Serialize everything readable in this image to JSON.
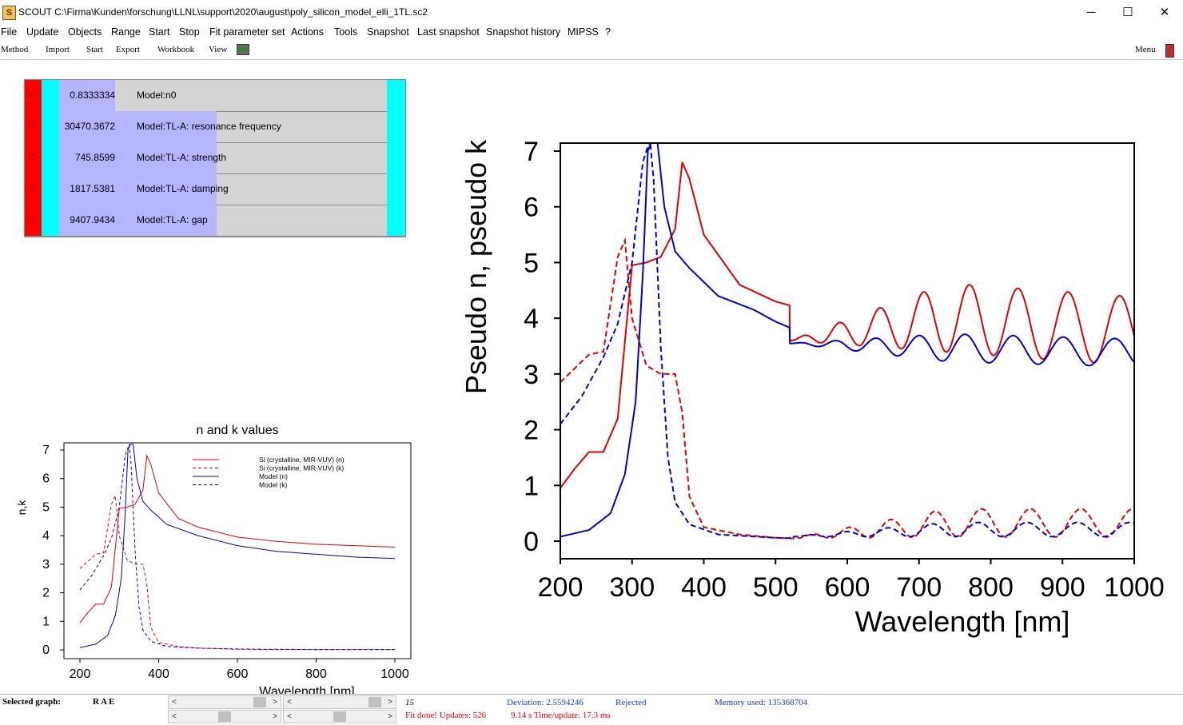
{
  "window": {
    "title": "SCOUT C:\\Firma\\Kunden\\forschung\\LLNL\\support\\2020\\august\\poly_silicon_model_elli_1TL.sc2",
    "minimize": "─",
    "maximize": "☐",
    "close": "✕"
  },
  "menu": [
    "File",
    "Update",
    "Objects",
    "Range",
    "Start",
    "Stop",
    "Fit parameter set",
    "Actions",
    "Tools",
    "Snapshot",
    "Last snapshot",
    "Snapshot history",
    "MIPSS",
    "?"
  ],
  "toolbar": {
    "items": [
      "Method",
      "Import",
      "Start",
      "Export",
      "Workbook",
      "View"
    ],
    "menu_label": "Menu"
  },
  "parameters": [
    {
      "flag": "D",
      "value": "0.8333334",
      "name": "Model:n0",
      "fill": 0
    },
    {
      "flag": "D",
      "value": "30470.3672",
      "name": "Model:TL-A: resonance frequency",
      "fill": 0.48
    },
    {
      "flag": "D",
      "value": "745.8599",
      "name": "Model:TL-A: strength",
      "fill": 0.48
    },
    {
      "flag": "D",
      "value": "1817.5381",
      "name": "Model:TL-A: damping",
      "fill": 0.48
    },
    {
      "flag": "D",
      "value": "9407.9434",
      "name": "Model:TL-A: gap",
      "fill": 0.48
    }
  ],
  "small_chart": {
    "title": "n and k values",
    "ylabel": "n,k",
    "xlabel": "Wavelength [nm]",
    "xticks": [
      "200",
      "400",
      "600",
      "800",
      "1000"
    ],
    "yticks": [
      "0",
      "1",
      "2",
      "3",
      "4",
      "5",
      "6",
      "7"
    ],
    "legend": [
      {
        "label": "Si (crystalline, MIR-VUV) (n)",
        "color": "#e00000",
        "dash": false
      },
      {
        "label": "Si (crystalline, MIR-VUV) (k)",
        "color": "#e00000",
        "dash": true
      },
      {
        "label": "Model (n)",
        "color": "#0000d0",
        "dash": false
      },
      {
        "label": "Model (k)",
        "color": "#0000d0",
        "dash": true
      }
    ]
  },
  "big_chart": {
    "ylabel": "Pseudo n, pseudo k",
    "xlabel": "Wavelength [nm]",
    "xticks": [
      "200",
      "300",
      "400",
      "500",
      "600",
      "700",
      "800",
      "900",
      "1000"
    ],
    "yticks": [
      "0",
      "1",
      "2",
      "3",
      "4",
      "5",
      "6",
      "7"
    ]
  },
  "chart_data": [
    {
      "type": "line",
      "title": "n and k values",
      "xlabel": "Wavelength [nm]",
      "ylabel": "n,k",
      "xlim": [
        200,
        1000
      ],
      "ylim": [
        0,
        7
      ],
      "series": [
        {
          "name": "Si (crystalline, MIR-VUV) (n)",
          "x": [
            200,
            220,
            240,
            260,
            280,
            300,
            320,
            340,
            360,
            370,
            380,
            400,
            450,
            500,
            600,
            700,
            800,
            900,
            1000
          ],
          "y": [
            0.95,
            1.3,
            1.6,
            1.6,
            2.2,
            4.95,
            5.0,
            5.1,
            5.6,
            6.8,
            6.5,
            5.5,
            4.6,
            4.3,
            3.95,
            3.8,
            3.7,
            3.65,
            3.6
          ]
        },
        {
          "name": "Si (crystalline, MIR-VUV) (k)",
          "x": [
            200,
            220,
            240,
            260,
            280,
            290,
            300,
            320,
            340,
            360,
            370,
            380,
            400,
            450,
            500,
            600,
            700,
            800,
            900,
            1000
          ],
          "y": [
            2.85,
            3.1,
            3.35,
            3.4,
            5.1,
            5.4,
            4.0,
            3.15,
            3.0,
            3.0,
            2.3,
            0.8,
            0.25,
            0.12,
            0.06,
            0.02,
            0.01,
            0.01,
            0.01,
            0.01
          ]
        },
        {
          "name": "Model (n)",
          "x": [
            200,
            240,
            270,
            290,
            305,
            315,
            322,
            328,
            335,
            345,
            360,
            380,
            420,
            500,
            600,
            700,
            800,
            900,
            1000
          ],
          "y": [
            0.08,
            0.2,
            0.5,
            1.2,
            2.5,
            4.8,
            7.0,
            7.2,
            7.2,
            6.0,
            5.2,
            4.9,
            4.4,
            4.0,
            3.65,
            3.45,
            3.35,
            3.25,
            3.2
          ]
        },
        {
          "name": "Model (k)",
          "x": [
            200,
            230,
            260,
            280,
            300,
            315,
            325,
            330,
            340,
            350,
            360,
            380,
            420,
            500,
            600,
            700,
            800,
            900,
            1000
          ],
          "y": [
            2.1,
            2.6,
            3.3,
            3.9,
            5.0,
            6.8,
            7.2,
            6.5,
            3.5,
            1.5,
            0.7,
            0.3,
            0.12,
            0.06,
            0.03,
            0.02,
            0.01,
            0.01,
            0.01
          ]
        }
      ]
    },
    {
      "type": "line",
      "xlabel": "Wavelength [nm]",
      "ylabel": "Pseudo n, pseudo k",
      "xlim": [
        200,
        1000
      ],
      "ylim": [
        0,
        7
      ],
      "series": [
        {
          "x": [
            200,
            220,
            240,
            260,
            280,
            300,
            320,
            340,
            360,
            370,
            380,
            400,
            450,
            500,
            520
          ],
          "y": [
            0.95,
            1.3,
            1.6,
            1.6,
            2.2,
            4.95,
            5.0,
            5.1,
            5.6,
            6.8,
            6.5,
            5.5,
            4.6,
            4.3,
            4.2
          ]
        },
        {
          "x": [
            200,
            220,
            240,
            260,
            280,
            290,
            300,
            320,
            340,
            360,
            370,
            380,
            400,
            450,
            500,
            520
          ],
          "y": [
            2.85,
            3.1,
            3.35,
            3.4,
            5.1,
            5.4,
            4.0,
            3.15,
            3.0,
            3.0,
            2.3,
            0.8,
            0.25,
            0.12,
            0.06,
            0.06
          ]
        },
        {
          "x": [
            200,
            240,
            270,
            290,
            305,
            315,
            322,
            328,
            335,
            345,
            360,
            380,
            420,
            500,
            520
          ],
          "y": [
            0.08,
            0.2,
            0.5,
            1.2,
            2.5,
            4.8,
            7.0,
            7.2,
            7.2,
            6.0,
            5.2,
            4.9,
            4.4,
            4.0,
            3.9
          ]
        },
        {
          "x": [
            200,
            230,
            260,
            280,
            300,
            315,
            325,
            330,
            340,
            350,
            360,
            380,
            420,
            500,
            520
          ],
          "y": [
            2.1,
            2.6,
            3.3,
            3.9,
            5.0,
            6.8,
            7.2,
            6.5,
            3.5,
            1.5,
            0.7,
            0.3,
            0.12,
            0.06,
            0.05
          ]
        }
      ]
    }
  ],
  "status": {
    "selected_graph": "Selected graph:",
    "rae": "R  A  E",
    "iteration": "15",
    "deviation": "Deviation:   2.5594246",
    "rejected": "Rejected",
    "memory": "Memory used: 135368704",
    "fit_done": "Fit done! Updates:   526",
    "timing": "9.14 s  Time/update:   17.3 ms"
  },
  "colors": {
    "red": "#e00000",
    "blue": "#0000d0",
    "accent_cyan": "#00ffff",
    "param_blue": "#b4b4ff"
  }
}
